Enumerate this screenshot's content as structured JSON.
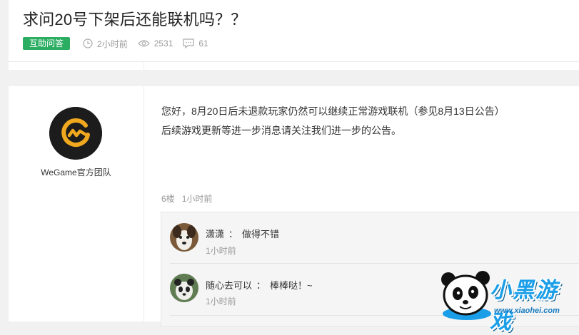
{
  "post": {
    "title": "求问20号下架后还能联机吗？？",
    "tag": "互助问答",
    "time": "2小时前",
    "views": "2531",
    "comments": "61"
  },
  "reply": {
    "author": "WeGame官方团队",
    "body_line1": "您好，8月20日后未退款玩家仍然可以继续正常游戏联机（参见8月13日公告）",
    "body_line2": "后续游戏更新等进一步消息请关注我们进一步的公告。",
    "floor": "6楼",
    "time": "1小时前"
  },
  "sub_comments": [
    {
      "user": "潇潇",
      "sep": "：",
      "text": "做得不错",
      "time": "1小时前"
    },
    {
      "user": "随心去可以",
      "sep": "：",
      "text": "棒棒哒！~",
      "time": "1小时前"
    }
  ],
  "watermark": {
    "text": "小黑游戏",
    "url": "www.xiaohei.com"
  },
  "colors": {
    "tag_green": "#2bad62",
    "logo_gold": "#f0a81e",
    "watermark_blue": "#1a9ee8"
  },
  "icons": {
    "time": "clock-icon",
    "views": "eye-icon",
    "comments": "comment-icon"
  }
}
